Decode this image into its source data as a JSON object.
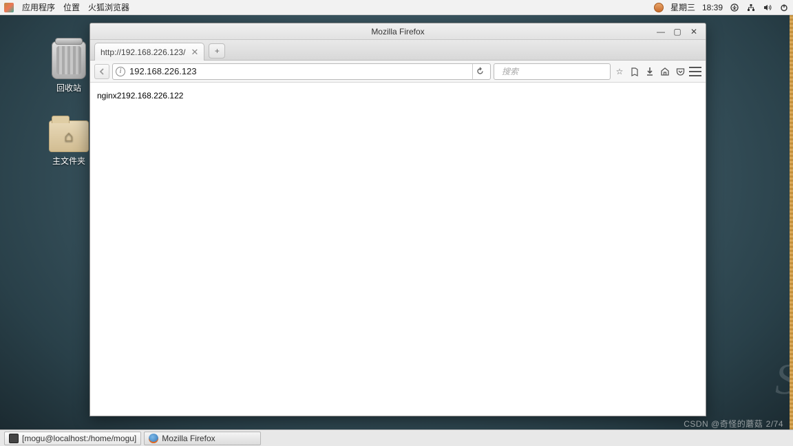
{
  "top_panel": {
    "menu": {
      "apps": "应用程序",
      "places": "位置",
      "firefox": "火狐浏览器"
    },
    "day": "星期三",
    "time": "18:39"
  },
  "desktop_icons": {
    "trash": "回收站",
    "home": "主文件夹"
  },
  "window": {
    "title": "Mozilla Firefox",
    "tab_title": "http://192.168.226.123/",
    "url": "192.168.226.123",
    "search_placeholder": "搜索",
    "page_text": "nginx2192.168.226.122"
  },
  "taskbar": {
    "terminal": "[mogu@localhost:/home/mogu]",
    "firefox": "Mozilla Firefox"
  },
  "watermark": "CSDN @奇怪的蘑菇",
  "num_badge": "2/74"
}
